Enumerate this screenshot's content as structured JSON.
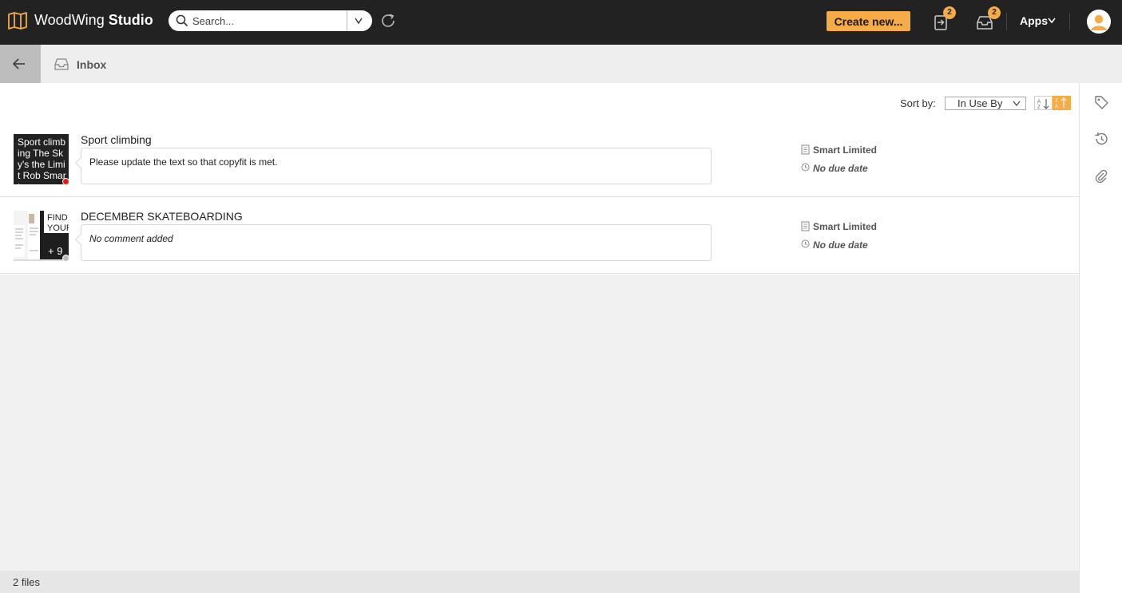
{
  "app": {
    "brand_regular": "WoodWing",
    "brand_bold": "Studio",
    "accent": "#f5ac48",
    "header_bg": "#222222"
  },
  "search": {
    "placeholder": "Search..."
  },
  "header": {
    "create_label": "Create new...",
    "tasks_badge": "2",
    "inbox_badge": "2",
    "apps_label": "Apps"
  },
  "breadcrumb": {
    "label": "Inbox"
  },
  "sort": {
    "label": "Sort by:",
    "selected": "In Use By"
  },
  "items": [
    {
      "title": "Sport climbing",
      "thumb_text": "Sport climbing The Sky's the Limit Rob Smart",
      "comment": "Please update the text so that copyfit is met.",
      "status": "Smart Limited",
      "due": "No due date",
      "status_color": "#e8161a"
    },
    {
      "title": "DECEMBER SKATEBOARDING",
      "thumb_text_1": "FIND",
      "thumb_text_2": "YOUR",
      "thumb_count": "+ 9",
      "comment": "No comment added",
      "status": "Smart Limited",
      "due": "No due date",
      "status_color": "#bbbbbb"
    }
  ],
  "footer": {
    "file_count": "2 files"
  }
}
